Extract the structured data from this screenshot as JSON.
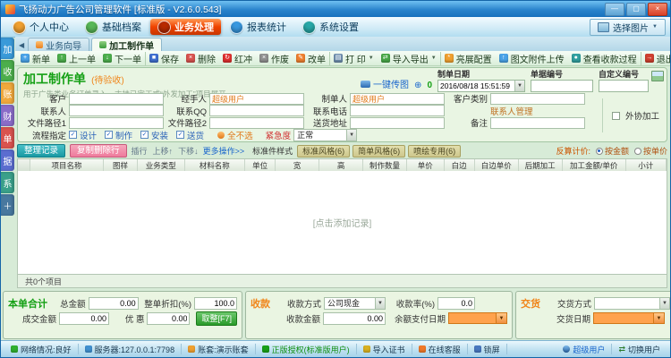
{
  "window": {
    "title": "飞扬动力广告公司管理软件 [标准版 - V2.6.0.543]",
    "minimize": "—",
    "maximize": "▢",
    "close": "×"
  },
  "menu": {
    "tabs": [
      {
        "label": "个人中心",
        "icon": "user-center-icon",
        "color": "#f0a030",
        "active": false
      },
      {
        "label": "基础档案",
        "icon": "archives-icon",
        "color": "#58b858",
        "active": false
      },
      {
        "label": "业务处理",
        "icon": "business-icon",
        "color": "#b82a00",
        "active": true
      },
      {
        "label": "报表统计",
        "icon": "reports-icon",
        "color": "#3898e0",
        "active": false
      },
      {
        "label": "系统设置",
        "icon": "settings-icon",
        "color": "#28a8a8",
        "active": false
      }
    ],
    "pick_image_label": "选择图片"
  },
  "side_tabs": [
    {
      "label": "加",
      "color": "#3a9ad9"
    },
    {
      "label": "收",
      "color": "#4cae4c"
    },
    {
      "label": "账",
      "color": "#f0a83c"
    },
    {
      "label": "财",
      "color": "#8a6cc8"
    },
    {
      "label": "单",
      "color": "#d9534f"
    },
    {
      "label": "据",
      "color": "#5b6dd0"
    },
    {
      "label": "系",
      "color": "#3aa08a"
    },
    {
      "label": "＋",
      "color": "#48789f"
    }
  ],
  "tabstrip": {
    "scroll_left": "◀",
    "tabs": [
      {
        "label": "业务向导",
        "active": false
      },
      {
        "label": "加工制作单",
        "active": true
      }
    ]
  },
  "toolbar": {
    "buttons": [
      {
        "label": "新单",
        "icon": "new-order-icon",
        "color": "#4aa3e8",
        "glyph": "+"
      },
      {
        "label": "上一单",
        "icon": "prev-order-icon",
        "color": "#4cae4c",
        "glyph": "↑"
      },
      {
        "label": "下一单",
        "icon": "next-order-icon",
        "color": "#4cae4c",
        "glyph": "↓"
      },
      {
        "label": "保存",
        "icon": "save-icon",
        "color": "#3f6fd0",
        "glyph": "■"
      },
      {
        "label": "删除",
        "icon": "delete-icon",
        "color": "#d9534f",
        "glyph": "×"
      },
      {
        "label": "红冲",
        "icon": "red-reverse-icon",
        "color": "#e03030",
        "glyph": "↻"
      },
      {
        "label": "作废",
        "icon": "void-icon",
        "color": "#909090",
        "glyph": "×"
      },
      {
        "label": "改单",
        "icon": "edit-order-icon",
        "color": "#f08030",
        "glyph": "✎"
      },
      {
        "label": "打 印",
        "icon": "print-icon",
        "color": "#7090b0",
        "glyph": "▤",
        "dropdown": true
      },
      {
        "label": "导入导出",
        "icon": "import-export-icon",
        "color": "#48a848",
        "glyph": "⇄",
        "dropdown": true
      },
      {
        "label": "亮展配置",
        "icon": "display-config-icon",
        "color": "#f0a030",
        "glyph": "*"
      },
      {
        "label": "图文附件上传",
        "icon": "attachment-upload-icon",
        "color": "#4aa3e8",
        "glyph": "↑"
      },
      {
        "label": "查看收款过程",
        "icon": "payment-history-icon",
        "color": "#30a0a0",
        "glyph": "●"
      },
      {
        "label": "退出",
        "icon": "exit-icon",
        "color": "#d04030",
        "glyph": "→"
      }
    ]
  },
  "form": {
    "title": "加工制作单",
    "status_tag": "(待验收)",
    "subtitle": "用于广告类业务订单录入，支持已完工或“外发加工”项目展开",
    "quick_upload_label": "一键传图",
    "attach_add": "⊕",
    "attach_count": "0",
    "date_label": "制单日期",
    "date_value": "2016/08/18 15:51:59",
    "billno_label": "单据编号",
    "billno_value": "",
    "custom_no_label": "自定义编号",
    "custom_no_value": "",
    "fields": [
      {
        "label": "客户",
        "value": ""
      },
      {
        "label": "经手人",
        "value": "超级用户"
      },
      {
        "label": "制单人",
        "value": "超级用户"
      },
      {
        "label": "客户类别",
        "value": ""
      },
      {
        "label": "联系人",
        "value": ""
      },
      {
        "label": "联系QQ",
        "value": ""
      },
      {
        "label": "联系电话",
        "value": ""
      },
      {
        "label": "文件路径1",
        "value": ""
      },
      {
        "label": "文件路径2",
        "value": ""
      },
      {
        "label": "送货地址",
        "value": ""
      },
      {
        "label": "备注",
        "value": ""
      }
    ],
    "contact_manage_label": "联系人管理",
    "process_label": "流程指定",
    "process_options": [
      {
        "label": "设计",
        "checked": true
      },
      {
        "label": "制作",
        "checked": true
      },
      {
        "label": "安装",
        "checked": true
      },
      {
        "label": "送货",
        "checked": true
      }
    ],
    "uncheck_all_label": "全不选",
    "urgency_label": "紧急度",
    "urgency_value": "正常",
    "outsource_label": "外协加工"
  },
  "grid": {
    "toolbar": {
      "organize_label": "整理记录",
      "copy_delete_label": "复制删除行",
      "links": [
        "插行",
        "上移↑",
        "下移↓"
      ],
      "more_label": "更多操作>>",
      "style_label": "标准件样式",
      "style_pills": [
        "标准风格(6)",
        "简单风格(6)",
        "喷绘专用(6)"
      ],
      "reverse_label": "反算计价:",
      "by_amount_label": "按金额",
      "by_price_label": "按单价"
    },
    "columns": [
      "项目名称",
      "图样",
      "业务类型",
      "材料名称",
      "单位",
      "宽",
      "高",
      "制作数量",
      "单价",
      "白边",
      "白边单价",
      "后期加工",
      "加工金额/单价",
      "小计"
    ],
    "empty_text": "[点击添加记录]",
    "footer_text": "共0个项目"
  },
  "totals": {
    "title": "本单合计",
    "total_label": "总金额",
    "total_value": "0.00",
    "discount_label": "整单折扣(%)",
    "discount_value": "100.0",
    "final_label": "成交金额",
    "final_value": "0.00",
    "concession_label": "优 惠",
    "concession_value": "0.00",
    "round_button": "取整[F7]"
  },
  "payment": {
    "title": "收款",
    "method_label": "收款方式",
    "method_value": "公司现金",
    "rate_label": "收款率(%)",
    "rate_value": "0.0",
    "amount_label": "收款金额",
    "amount_value": "0.00",
    "balance_date_label": "余额支付日期",
    "balance_date_value": ""
  },
  "delivery": {
    "title": "交货",
    "method_label": "交货方式",
    "method_value": "",
    "date_label": "交货日期",
    "date_value": ""
  },
  "statusbar": {
    "items": [
      {
        "label": "网络情况:良好",
        "icon": "network-icon",
        "icon_color": "#30b030"
      },
      {
        "label": "服务器:127.0.0.1:7798",
        "icon": "server-icon",
        "icon_color": "#4090d0"
      },
      {
        "label": "账套:演示账套",
        "icon": "account-set-icon",
        "icon_color": "#f0a030"
      },
      {
        "label": "正版授权(标准版用户)",
        "icon": "license-check-icon",
        "icon_color": "#18a018",
        "label_color": "#129012"
      },
      {
        "label": "导入证书",
        "icon": "key-icon",
        "icon_color": "#d8b020"
      },
      {
        "label": "在线客服",
        "icon": "customer-service-icon",
        "icon_color": "#f07828"
      },
      {
        "label": "锁屏",
        "icon": "lock-screen-icon",
        "icon_color": "#4878c0"
      }
    ],
    "user_label": "超级用户",
    "switch_label": "切换用户"
  }
}
